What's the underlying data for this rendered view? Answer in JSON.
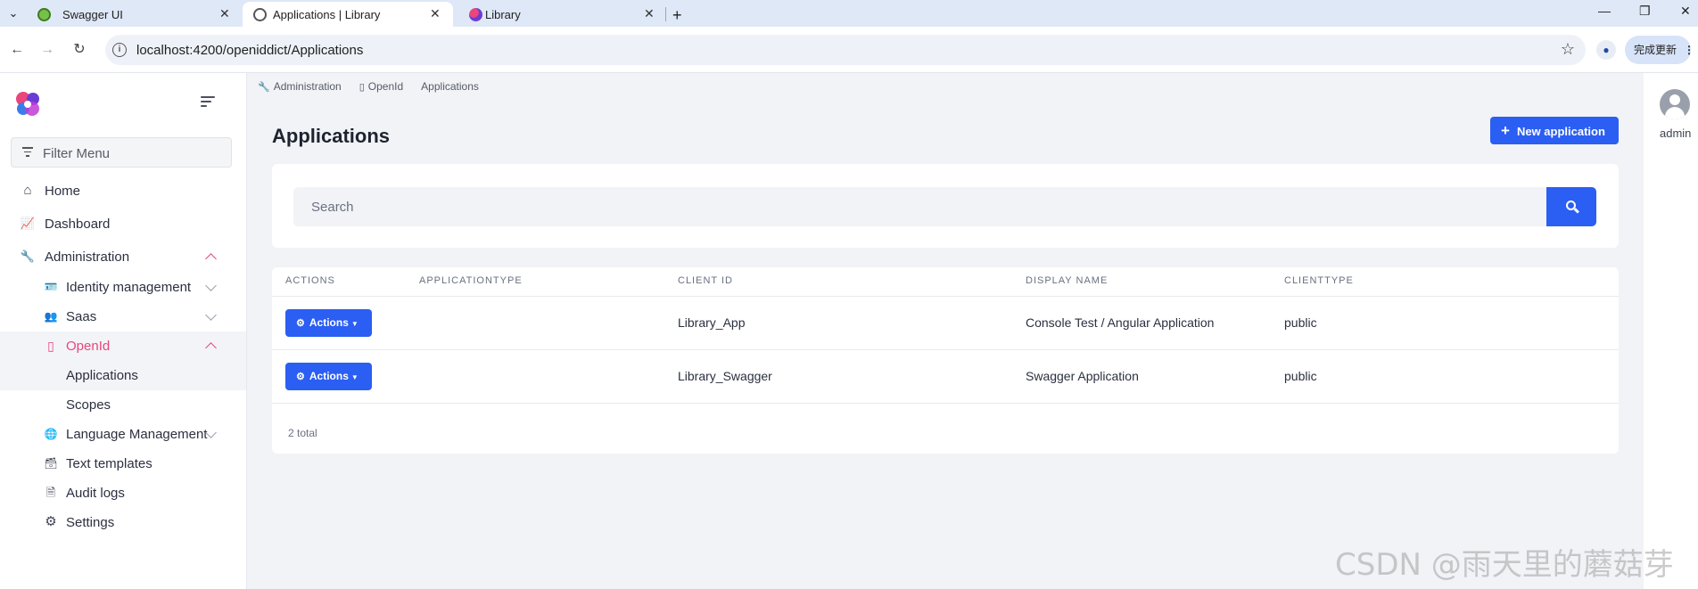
{
  "browser": {
    "tabs": [
      {
        "label": "Swagger UI",
        "active": false
      },
      {
        "label": "Applications | Library",
        "active": true
      },
      {
        "label": "Library",
        "active": false
      }
    ],
    "url": "localhost:4200/openiddict/Applications",
    "update_label": "完成更新",
    "icons": {
      "back": "←",
      "forward": "→",
      "reload": "↻",
      "star": "☆",
      "new_tab": "+",
      "minimize": "—",
      "restore": "❐",
      "close": "✕",
      "tab_close": "✕",
      "tab_menu": "⌄",
      "menu": "⋮"
    }
  },
  "sidebar": {
    "filter_placeholder": "Filter Menu",
    "items": [
      {
        "label": "Home",
        "icon": "home-icon",
        "glyph": "⌂"
      },
      {
        "label": "Dashboard",
        "icon": "chart-line-icon",
        "glyph": "📈"
      },
      {
        "label": "Administration",
        "icon": "wrench-icon",
        "glyph": "🔧",
        "expanded": true
      },
      {
        "label": "Identity management",
        "icon": "id-card-icon",
        "glyph": "🪪"
      },
      {
        "label": "Saas",
        "icon": "users-icon",
        "glyph": "👥"
      },
      {
        "label": "OpenId",
        "icon": "id-badge-icon",
        "glyph": "▯",
        "expanded": true
      },
      {
        "label": "Applications",
        "active": true
      },
      {
        "label": "Scopes"
      },
      {
        "label": "Language Management",
        "icon": "globe-icon",
        "glyph": "🌐"
      },
      {
        "label": "Text templates",
        "icon": "inbox-icon",
        "glyph": "🗃"
      },
      {
        "label": "Audit logs",
        "icon": "file-icon",
        "glyph": "🗎"
      },
      {
        "label": "Settings",
        "icon": "gear-icon",
        "glyph": "⚙"
      }
    ]
  },
  "breadcrumb": [
    {
      "label": "Administration",
      "icon": "wrench-icon",
      "glyph": "🔧"
    },
    {
      "label": "OpenId",
      "icon": "id-badge-icon",
      "glyph": "▯"
    },
    {
      "label": "Applications"
    }
  ],
  "page": {
    "title": "Applications",
    "new_button": "New application",
    "search_placeholder": "Search"
  },
  "table": {
    "columns": [
      "ACTIONS",
      "APPLICATIONTYPE",
      "CLIENT ID",
      "DISPLAY NAME",
      "CLIENTTYPE"
    ],
    "rows": [
      {
        "action": "Actions",
        "application_type": "",
        "client_id": "Library_App",
        "display_name": "Console Test / Angular Application",
        "client_type": "public"
      },
      {
        "action": "Actions",
        "application_type": "",
        "client_id": "Library_Swagger",
        "display_name": "Swagger Application",
        "client_type": "public"
      }
    ],
    "total": "2 total"
  },
  "user": {
    "name": "admin"
  },
  "watermark": "CSDN @雨天里的蘑菇芽",
  "colors": {
    "primary": "#2b5ef2",
    "accent_pink": "#e8467c",
    "sidebar_bg": "#ffffff",
    "content_bg": "#f1f3f6"
  }
}
